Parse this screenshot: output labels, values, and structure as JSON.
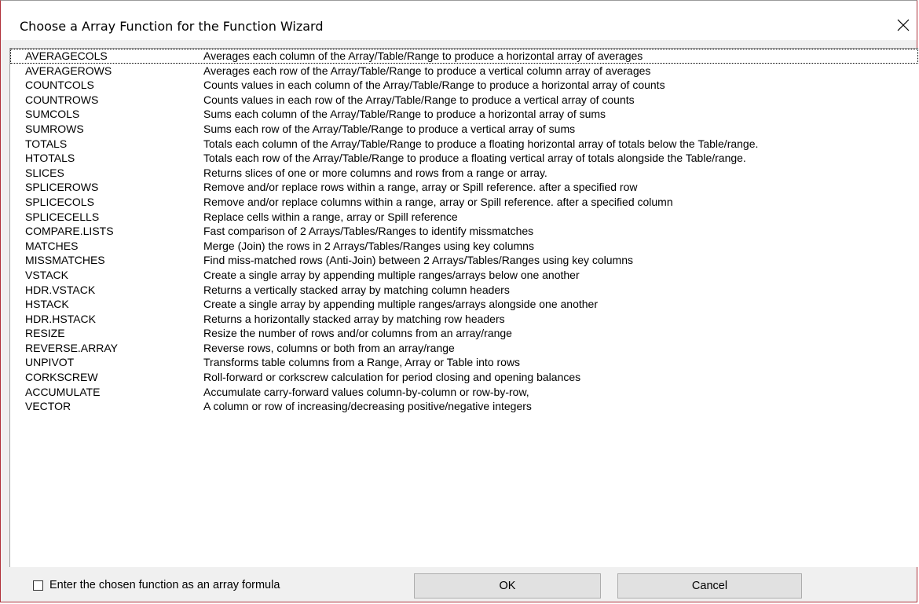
{
  "window": {
    "title": "Choose a Array Function for the Function Wizard",
    "close_icon": "close-icon"
  },
  "functions": [
    {
      "name": "AVERAGECOLS",
      "description": "Averages each column of the Array/Table/Range to produce a horizontal array of averages"
    },
    {
      "name": "AVERAGEROWS",
      "description": "Averages each row of the Array/Table/Range to produce a vertical column array of averages"
    },
    {
      "name": "COUNTCOLS",
      "description": "Counts values in each column of the Array/Table/Range to produce a horizontal array of counts"
    },
    {
      "name": "COUNTROWS",
      "description": "Counts values in each row of the Array/Table/Range to produce a vertical array of counts"
    },
    {
      "name": "SUMCOLS",
      "description": "Sums each column of the Array/Table/Range to produce a horizontal array of sums"
    },
    {
      "name": "SUMROWS",
      "description": "Sums each row of the Array/Table/Range to produce a vertical array of sums"
    },
    {
      "name": "TOTALS",
      "description": "Totals each column of the Array/Table/Range to produce a floating horizontal array of totals below the Table/range."
    },
    {
      "name": "HTOTALS",
      "description": "Totals each row of the Array/Table/Range to produce a floating vertical array of totals alongside the Table/range."
    },
    {
      "name": "SLICES",
      "description": "Returns slices of one or more columns and rows from a range or array."
    },
    {
      "name": "SPLICEROWS",
      "description": "Remove and/or replace rows within a range, array or Spill reference. after a specified row"
    },
    {
      "name": "SPLICECOLS",
      "description": "Remove and/or replace columns within a range, array or Spill reference. after a specified column"
    },
    {
      "name": "SPLICECELLS",
      "description": "Replace cells within a range, array or Spill reference"
    },
    {
      "name": "COMPARE.LISTS",
      "description": "Fast comparison of 2 Arrays/Tables/Ranges to identify missmatches"
    },
    {
      "name": "MATCHES",
      "description": "Merge (Join) the rows in 2 Arrays/Tables/Ranges using key columns"
    },
    {
      "name": "MISSMATCHES",
      "description": "Find miss-matched rows (Anti-Join) between 2 Arrays/Tables/Ranges using key columns"
    },
    {
      "name": "VSTACK",
      "description": "Create a single array by appending multiple ranges/arrays below one another"
    },
    {
      "name": "HDR.VSTACK",
      "description": "Returns a vertically stacked array by matching column headers"
    },
    {
      "name": "HSTACK",
      "description": "Create a single array by appending multiple ranges/arrays alongside one another"
    },
    {
      "name": "HDR.HSTACK",
      "description": "Returns a horizontally stacked array by matching row headers"
    },
    {
      "name": "RESIZE",
      "description": "Resize the number of rows and/or columns from an array/range"
    },
    {
      "name": "REVERSE.ARRAY",
      "description": "Reverse rows, columns or both from an array/range"
    },
    {
      "name": "UNPIVOT",
      "description": "Transforms  table columns from a Range, Array or Table into rows"
    },
    {
      "name": "CORKSCREW",
      "description": "Roll-forward or corkscrew calculation for period closing and opening balances"
    },
    {
      "name": "ACCUMULATE",
      "description": "Accumulate carry-forward values column-by-column or row-by-row,"
    },
    {
      "name": "VECTOR",
      "description": "A column or row of increasing/decreasing positive/negative integers"
    }
  ],
  "footer": {
    "array_formula_label": "Enter the chosen function as an array formula",
    "array_formula_checked": false,
    "ok_label": "OK",
    "cancel_label": "Cancel"
  },
  "colors": {
    "window_border": "#b0313a",
    "dialog_background": "#f0f0f0",
    "button_background": "#e1e1e1"
  }
}
